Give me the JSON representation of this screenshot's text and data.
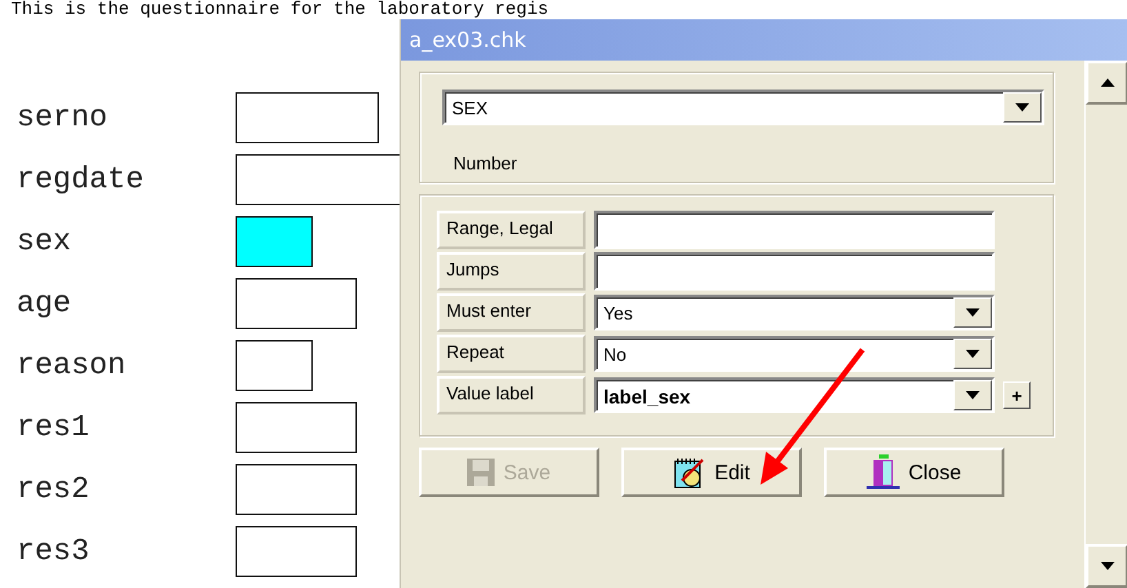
{
  "heading": "This is the questionnaire for the laboratory regis",
  "form_fields": [
    {
      "label": "serno",
      "highlighted": false
    },
    {
      "label": "regdate",
      "highlighted": false
    },
    {
      "label": "sex",
      "highlighted": true
    },
    {
      "label": "age",
      "highlighted": false
    },
    {
      "label": "reason",
      "highlighted": false
    },
    {
      "label": "res1",
      "highlighted": false
    },
    {
      "label": "res2",
      "highlighted": false
    },
    {
      "label": "res3",
      "highlighted": false
    }
  ],
  "dialog": {
    "title": "a_ex03.chk",
    "field_select": "SEX",
    "field_type": "Number",
    "properties": [
      {
        "kind": "text",
        "label": "Range, Legal"
      },
      {
        "kind": "text",
        "label": "Jumps"
      },
      {
        "kind": "select",
        "label": "Must enter",
        "value": "Yes"
      },
      {
        "kind": "select",
        "label": "Repeat",
        "value": "No"
      },
      {
        "kind": "select_add",
        "label": "Value label",
        "value": "label_sex",
        "add": "+"
      }
    ],
    "buttons": [
      {
        "kind": "save",
        "label": "Save",
        "disabled": true
      },
      {
        "kind": "edit",
        "label": "Edit",
        "disabled": false
      },
      {
        "kind": "close",
        "label": "Close",
        "disabled": false
      }
    ]
  }
}
